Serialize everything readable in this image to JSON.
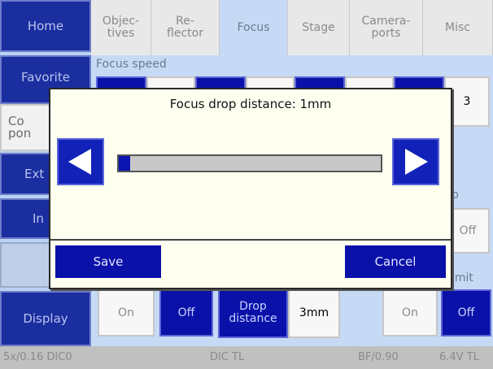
{
  "nav": {
    "home": "Home",
    "favorite": "Favorite",
    "components": "Co\npon",
    "ext": "Ext",
    "in": "In",
    "display": "Display"
  },
  "tabs": [
    {
      "label": "Objec-\ntives"
    },
    {
      "label": "Re-\nflector"
    },
    {
      "label": "Focus"
    },
    {
      "label": "Stage"
    },
    {
      "label": "Camera-\nports"
    },
    {
      "label": "Misc"
    }
  ],
  "focus": {
    "speed_label": "Focus speed",
    "speed_value": "3",
    "step_label_partial": "p",
    "off_right": "Off",
    "limit_label_partial": "imit"
  },
  "bottom_row": {
    "on1": "On",
    "off1": "Off",
    "drop_distance": "Drop\ndistance",
    "drop_value": "3mm",
    "on2": "On",
    "off2": "Off"
  },
  "dialog": {
    "title": "Focus drop distance: 1mm",
    "slider_fraction": 0.04,
    "save": "Save",
    "cancel": "Cancel"
  },
  "status": {
    "objective": "5x/0.16 DIC0",
    "method": "DIC TL",
    "condenser": "BF/0.90",
    "lamp": "6.4V TL"
  },
  "colors": {
    "accent_blue": "#0a11a8",
    "panel_blue": "#c6daf6",
    "dialog_bg": "#fffff0"
  }
}
